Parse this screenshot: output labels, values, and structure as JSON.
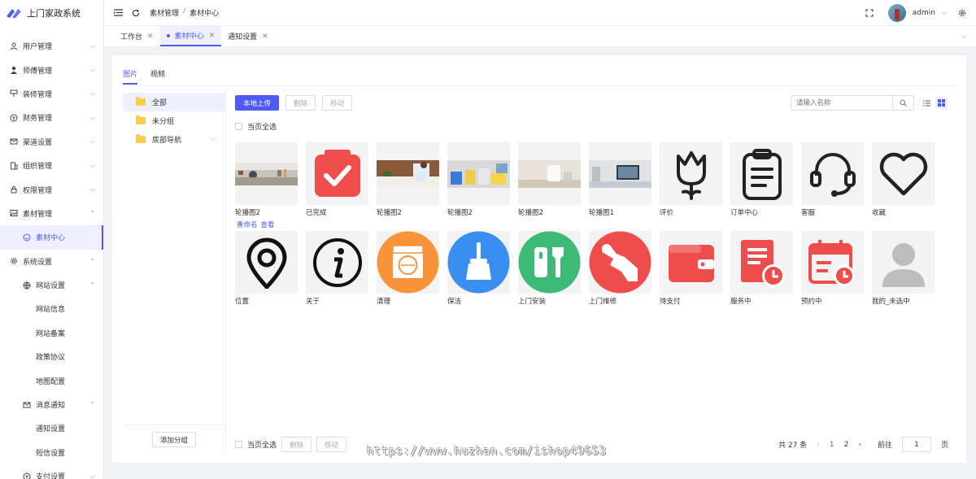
{
  "app": {
    "title": "上门家政系统"
  },
  "sidebar": {
    "items": [
      {
        "label": "用户管理",
        "icon": "user-icon"
      },
      {
        "label": "师傅管理",
        "icon": "worker-icon"
      },
      {
        "label": "装修管理",
        "icon": "paint-icon"
      },
      {
        "label": "财务管理",
        "icon": "money-icon"
      },
      {
        "label": "渠道设置",
        "icon": "mail-icon"
      },
      {
        "label": "组织管理",
        "icon": "building-icon"
      },
      {
        "label": "权限管理",
        "icon": "lock-icon"
      },
      {
        "label": "素材管理",
        "icon": "image-icon"
      },
      {
        "label": "素材中心",
        "icon": "smile-icon"
      },
      {
        "label": "系统设置",
        "icon": "gear-icon"
      },
      {
        "label": "网站设置",
        "icon": "globe-icon"
      },
      {
        "label": "网站信息"
      },
      {
        "label": "网站备案"
      },
      {
        "label": "政策协议"
      },
      {
        "label": "地图配置"
      },
      {
        "label": "消息通知",
        "icon": "mail-icon"
      },
      {
        "label": "通知设置"
      },
      {
        "label": "短信设置"
      },
      {
        "label": "支付设置",
        "icon": "pay-icon"
      }
    ]
  },
  "header": {
    "breadcrumb": [
      "素材管理",
      "素材中心"
    ],
    "username": "admin"
  },
  "tabs": [
    {
      "label": "工作台"
    },
    {
      "label": "素材中心"
    },
    {
      "label": "通知设置"
    }
  ],
  "content": {
    "subtabs": [
      "图片",
      "视频"
    ],
    "groups": [
      "全部",
      "未分组",
      "底部导航"
    ],
    "add_group": "添加分组",
    "upload": "本地上传",
    "delete": "删除",
    "move": "移动",
    "search_placeholder": "请输入名称",
    "select_page": "当页全选",
    "items": [
      {
        "name": "轮播图2",
        "thumb": "photo-kitchen"
      },
      {
        "name": "已完成",
        "thumb": "check-icon"
      },
      {
        "name": "轮播图2",
        "thumb": "photo-cleaning"
      },
      {
        "name": "轮播图2",
        "thumb": "photo-gloves"
      },
      {
        "name": "轮播图2",
        "thumb": "photo-towels"
      },
      {
        "name": "轮播图1",
        "thumb": "photo-desk"
      },
      {
        "name": "评价",
        "thumb": "tulip-icon"
      },
      {
        "name": "订单中心",
        "thumb": "clipboard-icon"
      },
      {
        "name": "客服",
        "thumb": "headset-icon"
      },
      {
        "name": "收藏",
        "thumb": "heart-icon"
      },
      {
        "name": "位置",
        "thumb": "location-icon"
      },
      {
        "name": "关于",
        "thumb": "info-icon"
      },
      {
        "name": "清理",
        "thumb": "washer-icon"
      },
      {
        "name": "保洁",
        "thumb": "broom-icon"
      },
      {
        "name": "上门安装",
        "thumb": "tools-icon"
      },
      {
        "name": "上门维修",
        "thumb": "repair-icon"
      },
      {
        "name": "待支付",
        "thumb": "wallet-icon"
      },
      {
        "name": "服务中",
        "thumb": "doc-clock-icon"
      },
      {
        "name": "预约中",
        "thumb": "calendar-clock-icon"
      },
      {
        "name": "我的_未选中",
        "thumb": "person-icon"
      }
    ],
    "item_actions": [
      "重命名",
      "查看"
    ],
    "pager": {
      "total": "共 27 条",
      "pages": [
        "1",
        "2"
      ],
      "goto_label": "前往",
      "goto_value": "1",
      "page_suffix": "页"
    }
  },
  "watermark": "https://www.huzhan.com/ishop49653"
}
